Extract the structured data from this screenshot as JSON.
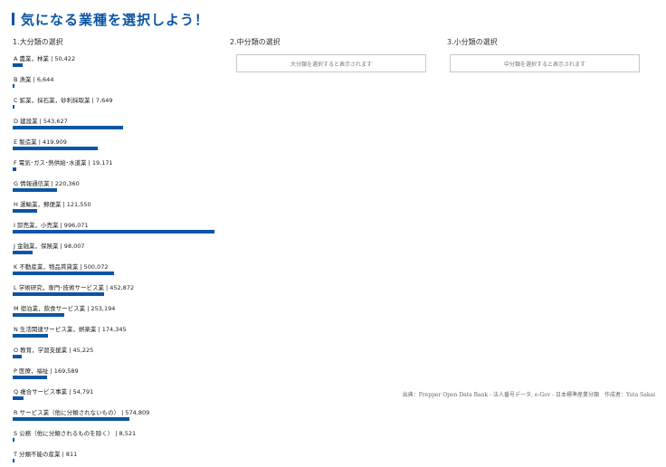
{
  "page": {
    "title": "気になる業種を選択しよう！"
  },
  "columns": {
    "large": {
      "heading": "1.大分類の選択"
    },
    "medium": {
      "heading": "2.中分類の選択",
      "placeholder": "大分類を選択すると表示されます"
    },
    "small": {
      "heading": "3.小分類の選択",
      "placeholder": "中分類を選択すると表示されます"
    }
  },
  "industries": [
    {
      "label": "A 農業，林業 | 50,422",
      "count": 50422
    },
    {
      "label": "B 漁業 | 6,644",
      "count": 6644
    },
    {
      "label": "C 鉱業，採石業，砂利採取業 | 7,649",
      "count": 7649
    },
    {
      "label": "D 建設業 | 543,627",
      "count": 543627
    },
    {
      "label": "E 製造業 | 419,909",
      "count": 419909
    },
    {
      "label": "F 電気･ガス･熱供給･水道業 | 19,171",
      "count": 19171
    },
    {
      "label": "G 情報通信業 | 220,360",
      "count": 220360
    },
    {
      "label": "H 運輸業，郵便業 | 121,550",
      "count": 121550
    },
    {
      "label": "I 卸売業，小売業 | 996,071",
      "count": 996071
    },
    {
      "label": "J 金融業，保険業 | 98,007",
      "count": 98007
    },
    {
      "label": "K 不動産業，物品賃貸業 | 500,072",
      "count": 500072
    },
    {
      "label": "L 学術研究，専門･技術サービス業 | 452,872",
      "count": 452872
    },
    {
      "label": "M 宿泊業，飲食サービス業 | 253,194",
      "count": 253194
    },
    {
      "label": "N 生活関連サービス業，娯楽業 | 174,345",
      "count": 174345
    },
    {
      "label": "O 教育，学習支援業 | 45,225",
      "count": 45225
    },
    {
      "label": "P 医療，福祉 | 169,589",
      "count": 169589
    },
    {
      "label": "Q 複合サービス事業 | 54,791",
      "count": 54791
    },
    {
      "label": "R サービス業（他に分類されないもの） | 574,809",
      "count": 574809
    },
    {
      "label": "S 公務（他に分類されるものを除く） | 8,521",
      "count": 8521
    },
    {
      "label": "T 分類不能の産業 | 811",
      "count": 811
    }
  ],
  "colors": {
    "accent": "#0b55a5"
  },
  "footer": {
    "text": "出典：Prepper Open Data Bank - 法人番号データ, e-Gov - 日本標準産業分類　作成者：Yuta Sakai"
  }
}
